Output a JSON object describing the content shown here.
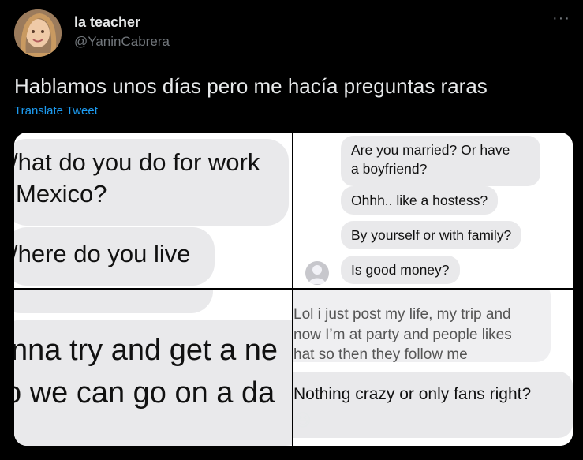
{
  "user": {
    "display_name": "la teacher",
    "handle": "@YaninCabrera",
    "avatar": "profile-photo"
  },
  "tweet": {
    "text": "Hablamos unos días pero me hacía preguntas raras",
    "translate_label": "Translate Tweet",
    "more_label": "···"
  },
  "media": {
    "top_left": {
      "line1": "/hat do you do for work",
      "line2": " Mexico?",
      "line3": "/here do you live",
      "line4": "nna try and get a ne",
      "line5": "o we can go on a da"
    },
    "top_right": {
      "messages": [
        "Are you married? Or have",
        "a boyfriend?",
        "Ohhh.. like a hostess?",
        "By yourself or with family?",
        "Is good money?"
      ]
    },
    "bottom_right": {
      "line1": "Lol i just post my life, my trip and",
      "line2": "now I’m at party and people likes",
      "line3": "hat so then they follow me",
      "line4": "Nothing crazy or only fans right?",
      "emoji": "😆"
    }
  },
  "colors": {
    "background": "#000000",
    "text": "#e7e9ea",
    "muted": "#71767b",
    "link": "#1d9bf0",
    "bubble": "#e9e9eb"
  }
}
